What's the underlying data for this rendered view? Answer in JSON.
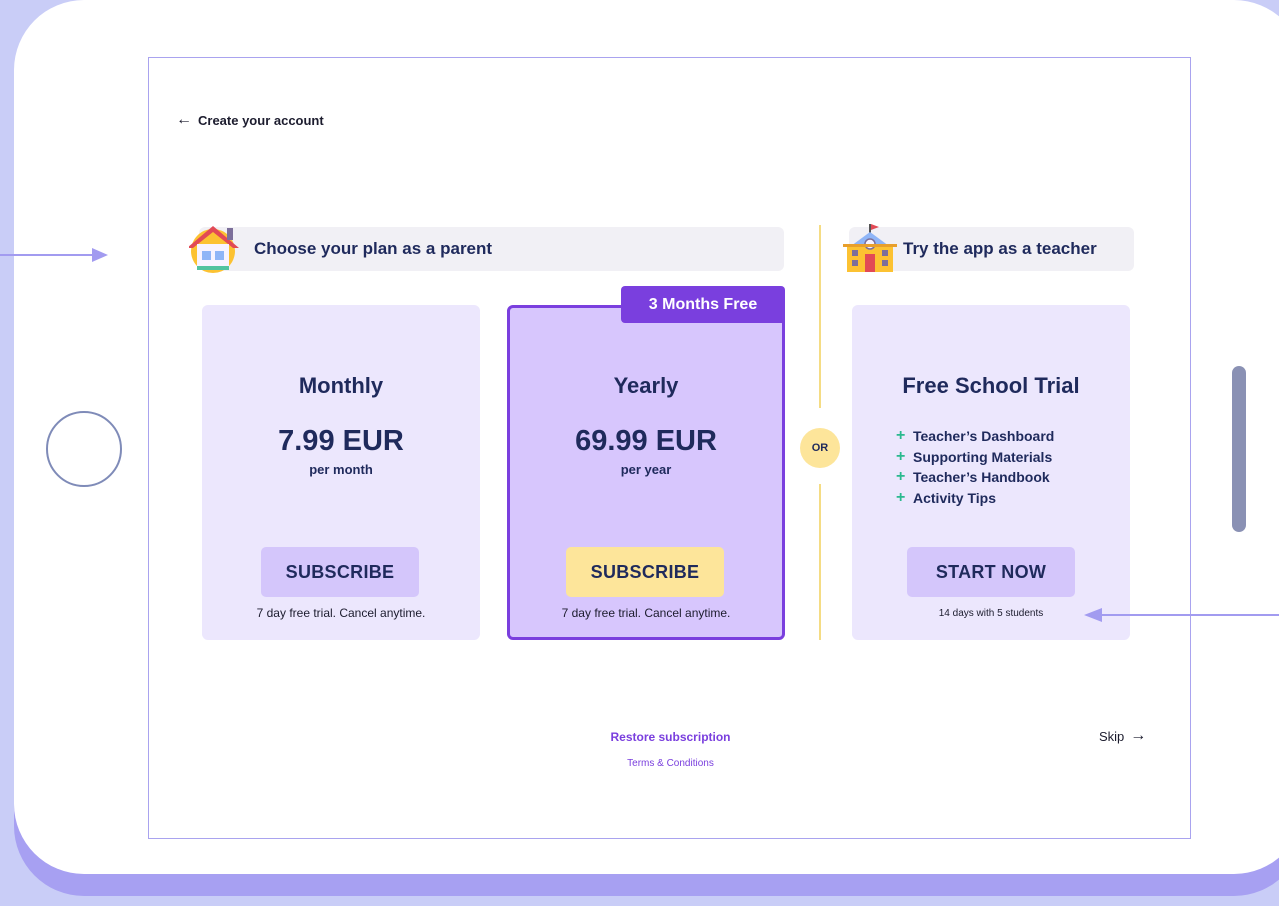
{
  "header": {
    "back_label": "Create your account"
  },
  "parent_section": {
    "title": "Choose your plan as a parent",
    "plans": [
      {
        "name": "Monthly",
        "price": "7.99 EUR",
        "period": "per month",
        "button": "SUBSCRIBE",
        "note": "7 day free trial. Cancel anytime."
      },
      {
        "name": "Yearly",
        "price": "69.99 EUR",
        "period": "per year",
        "button": "SUBSCRIBE",
        "note": "7 day free trial. Cancel anytime.",
        "badge": "3 Months Free"
      }
    ]
  },
  "divider": {
    "label": "OR"
  },
  "teacher_section": {
    "title": "Try the app as a teacher",
    "card": {
      "name": "Free School Trial",
      "features": [
        "Teacher’s Dashboard",
        "Supporting Materials",
        "Teacher’s Handbook",
        "Activity Tips"
      ],
      "button": "START NOW",
      "note": "14 days with 5 students"
    }
  },
  "footer": {
    "restore": "Restore subscription",
    "terms": "Terms & Conditions",
    "skip": "Skip"
  },
  "icons": {
    "back": "arrow-left-icon",
    "parent": "house-icon",
    "teacher": "school-icon",
    "feature": "plus-icon",
    "skip": "arrow-right-icon"
  },
  "colors": {
    "background": "#c9cdf7",
    "accent": "#7a3fde",
    "card": "#ece7fd",
    "card_selected": "#d7c6fd",
    "button_primary": "#fde59a",
    "button_secondary": "#d4c6fb",
    "text": "#1f2a5c",
    "check": "#2bb98f"
  }
}
